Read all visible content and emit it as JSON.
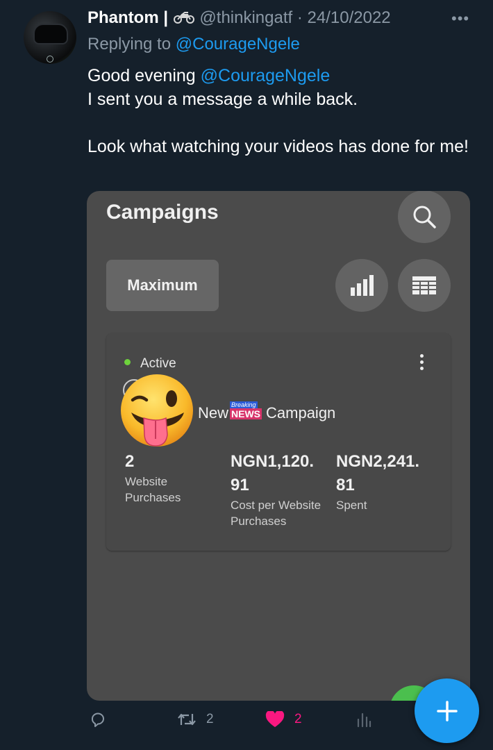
{
  "tweet": {
    "display_name": "Phantom |",
    "handle": "@thinkingatf",
    "separator": "·",
    "date": "24/10/2022",
    "replying_prefix": "Replying to",
    "replying_to": "@CourageNgele",
    "text_line1_prefix": "Good evening",
    "text_line1_mention": "@CourageNgele",
    "text_line2": "I sent you a message a while back.",
    "text_line3": "Look what watching your videos has done for me!"
  },
  "screenshot": {
    "title": "Campaigns",
    "maximum_label": "Maximum",
    "status": "Active",
    "campaign_name_left": "New",
    "campaign_name_right": "Campaign",
    "badge_top": "Breaking",
    "badge_bottom": "NEWS",
    "metrics": [
      {
        "value": "2",
        "label": "Website Purchases"
      },
      {
        "value": "NGN1,120. 91",
        "label": "Cost per Website Purchases"
      },
      {
        "value": "NGN2,241. 81",
        "label": "Spent"
      }
    ]
  },
  "actions": {
    "retweets": "2",
    "likes": "2"
  },
  "colors": {
    "background": "#15202b",
    "accent": "#1d9bf0",
    "secondary_text": "#8b98a5",
    "like": "#f91880"
  },
  "icons": [
    "motorcycle-icon",
    "more-icon",
    "search-icon",
    "bar-chart-icon",
    "table-icon",
    "more-vertical-icon",
    "wink-tongue-emoji",
    "reply-icon",
    "retweet-icon",
    "heart-icon",
    "analytics-icon",
    "plus-icon"
  ]
}
